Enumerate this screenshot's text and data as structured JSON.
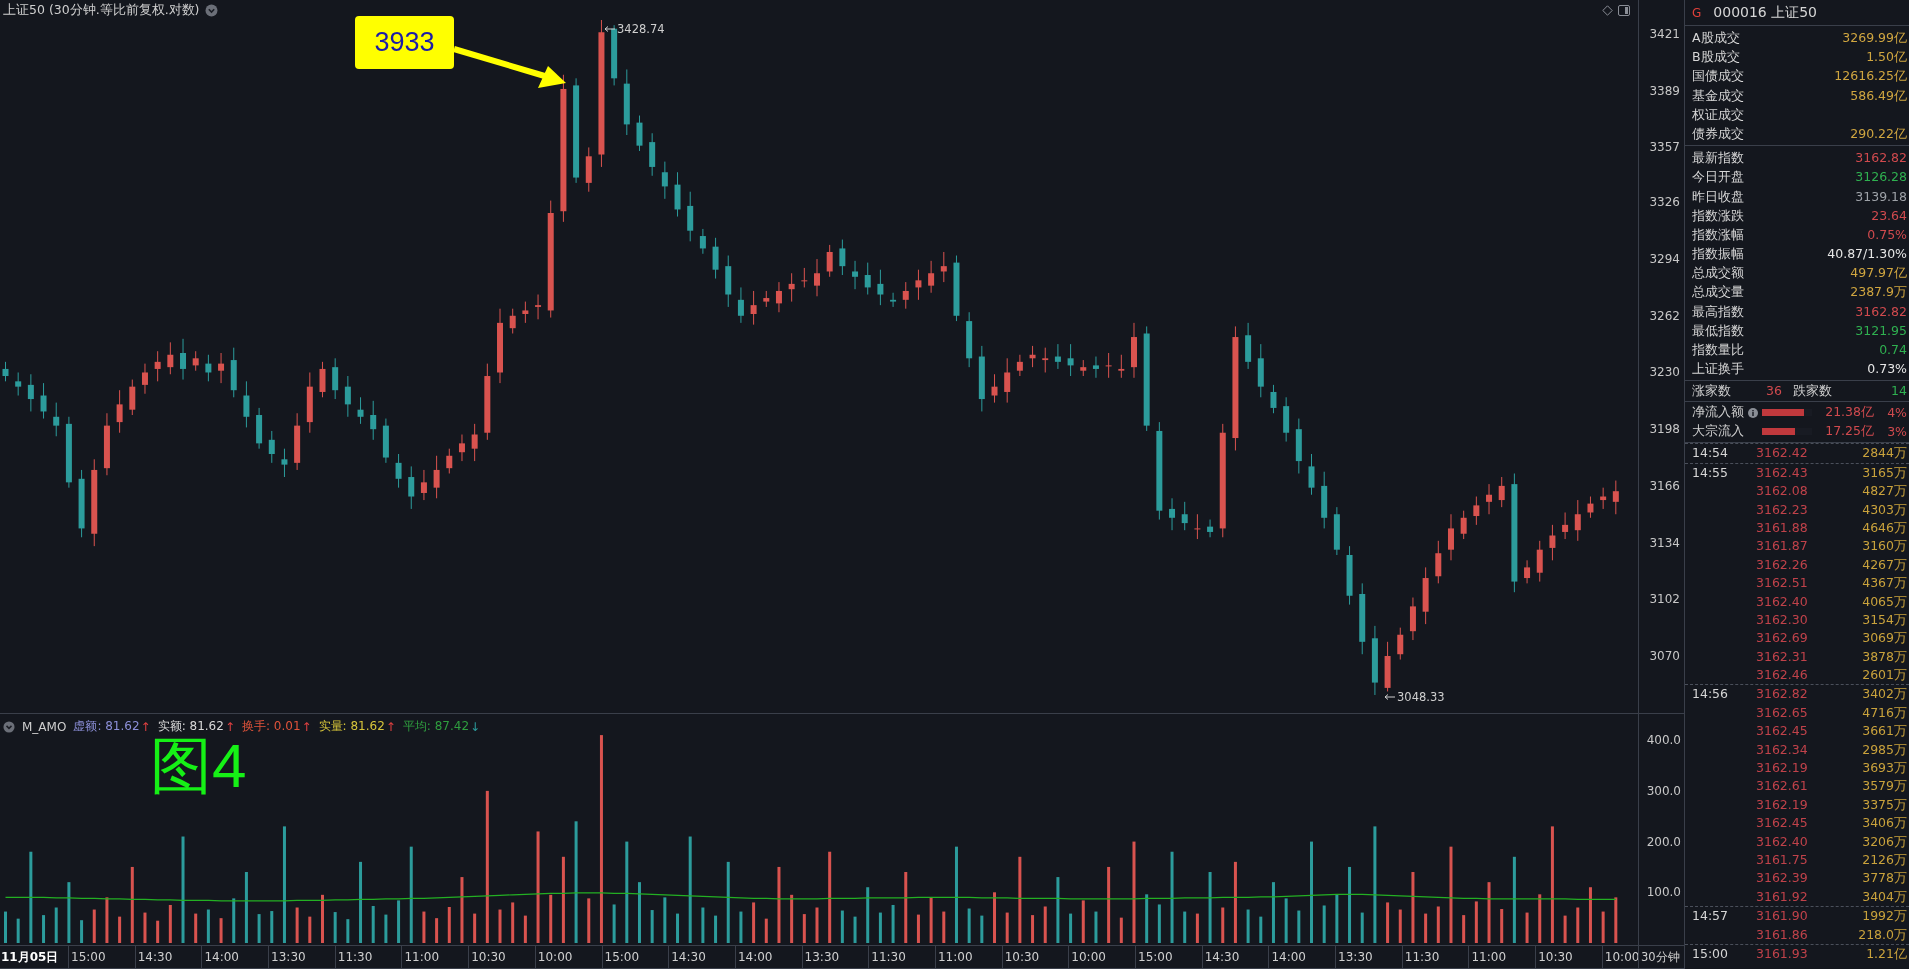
{
  "chart_header": {
    "title": "上证50 (30分钟.等比前复权.对数)"
  },
  "price_chart": {
    "chart_data": {
      "type": "candlestick",
      "categories": [
        null,
        null,
        null,
        null,
        null,
        null,
        null,
        null,
        null,
        null,
        null,
        null,
        null,
        null,
        null,
        null,
        null,
        null,
        null,
        null,
        null,
        null,
        null,
        null,
        null,
        null,
        null,
        null,
        null,
        null,
        null,
        null,
        null,
        null,
        null,
        null,
        null,
        null,
        null,
        null,
        null,
        null,
        null,
        null,
        null,
        null,
        null,
        null,
        null,
        null,
        null,
        null,
        null,
        null,
        null,
        null,
        null,
        null,
        null,
        null,
        null,
        null,
        null,
        null,
        null,
        null,
        null,
        null,
        null,
        null,
        null,
        null,
        null,
        null,
        null,
        null,
        null,
        null,
        null,
        null,
        null,
        null,
        null,
        null,
        null,
        null,
        null,
        null,
        null,
        null,
        null,
        null,
        null,
        null,
        null,
        null,
        null,
        null,
        null,
        null,
        null,
        null,
        null,
        null,
        null,
        null,
        null,
        null,
        null,
        null,
        null,
        null,
        null,
        null,
        null,
        null,
        null,
        null,
        null,
        null,
        null,
        null,
        null,
        null,
        null,
        null,
        null,
        null
      ],
      "ylim": [
        3038.4,
        3440.2
      ],
      "ohlc": [
        [
          3232,
          3236,
          3225,
          3228
        ],
        [
          3225,
          3230,
          3217,
          3222
        ],
        [
          3223,
          3229,
          3208,
          3215
        ],
        [
          3217,
          3224,
          3204,
          3208
        ],
        [
          3205,
          3213,
          3194,
          3200
        ],
        [
          3201,
          3205,
          3165,
          3168
        ],
        [
          3170,
          3175,
          3137,
          3142
        ],
        [
          3139,
          3181,
          3132,
          3175
        ],
        [
          3176,
          3207,
          3172,
          3200
        ],
        [
          3202,
          3220,
          3196,
          3212
        ],
        [
          3209,
          3226,
          3206,
          3222
        ],
        [
          3223,
          3235,
          3218,
          3230
        ],
        [
          3232,
          3242,
          3225,
          3236
        ],
        [
          3233,
          3247,
          3229,
          3240
        ],
        [
          3241,
          3249,
          3226,
          3232
        ],
        [
          3234,
          3242,
          3231,
          3238
        ],
        [
          3235,
          3240,
          3225,
          3230
        ],
        [
          3231,
          3241,
          3224,
          3235
        ],
        [
          3237,
          3244,
          3216,
          3220
        ],
        [
          3217,
          3225,
          3199,
          3205
        ],
        [
          3206,
          3210,
          3187,
          3190
        ],
        [
          3192,
          3197,
          3179,
          3184
        ],
        [
          3181,
          3187,
          3171,
          3178
        ],
        [
          3179,
          3207,
          3175,
          3200
        ],
        [
          3202,
          3230,
          3196,
          3222
        ],
        [
          3219,
          3236,
          3216,
          3232
        ],
        [
          3233,
          3238,
          3215,
          3220
        ],
        [
          3222,
          3228,
          3205,
          3212
        ],
        [
          3209,
          3216,
          3201,
          3205
        ],
        [
          3206,
          3214,
          3192,
          3198
        ],
        [
          3200,
          3204,
          3179,
          3182
        ],
        [
          3179,
          3184,
          3165,
          3170
        ],
        [
          3171,
          3177,
          3153,
          3160
        ],
        [
          3162,
          3175,
          3158,
          3168
        ],
        [
          3165,
          3183,
          3159,
          3175
        ],
        [
          3176,
          3187,
          3173,
          3183
        ],
        [
          3185,
          3195,
          3180,
          3190
        ],
        [
          3187,
          3201,
          3180,
          3195
        ],
        [
          3196,
          3235,
          3192,
          3228
        ],
        [
          3230,
          3266,
          3224,
          3258
        ],
        [
          3255,
          3266,
          3252,
          3262
        ],
        [
          3263,
          3270,
          3258,
          3265
        ],
        [
          3267,
          3274,
          3260,
          3268
        ],
        [
          3265,
          3327,
          3261,
          3320
        ],
        [
          3321,
          3398,
          3315,
          3390
        ],
        [
          3392,
          3396,
          3337,
          3340
        ],
        [
          3337,
          3357,
          3332,
          3352
        ],
        [
          3353,
          3429,
          3346,
          3422
        ],
        [
          3424,
          3426,
          3392,
          3396
        ],
        [
          3393,
          3401,
          3364,
          3370
        ],
        [
          3371,
          3375,
          3355,
          3358
        ],
        [
          3360,
          3365,
          3341,
          3346
        ],
        [
          3343,
          3349,
          3328,
          3335
        ],
        [
          3336,
          3343,
          3318,
          3322
        ],
        [
          3324,
          3332,
          3304,
          3310
        ],
        [
          3307,
          3311,
          3297,
          3300
        ],
        [
          3301,
          3306,
          3283,
          3288
        ],
        [
          3290,
          3296,
          3267,
          3274
        ],
        [
          3271,
          3278,
          3258,
          3262
        ],
        [
          3263,
          3276,
          3257,
          3268
        ],
        [
          3270,
          3276,
          3267,
          3272
        ],
        [
          3269,
          3281,
          3264,
          3276
        ],
        [
          3277,
          3286,
          3270,
          3280
        ],
        [
          3282,
          3289,
          3278,
          3282
        ],
        [
          3279,
          3294,
          3273,
          3286
        ],
        [
          3287,
          3302,
          3284,
          3298
        ],
        [
          3300,
          3305,
          3285,
          3290
        ],
        [
          3287,
          3293,
          3277,
          3284
        ],
        [
          3285,
          3292,
          3274,
          3278
        ],
        [
          3280,
          3288,
          3268,
          3274
        ],
        [
          3271,
          3275,
          3267,
          3270
        ],
        [
          3271,
          3281,
          3266,
          3276
        ],
        [
          3278,
          3288,
          3271,
          3282
        ],
        [
          3279,
          3293,
          3275,
          3286
        ],
        [
          3287,
          3298,
          3281,
          3290
        ],
        [
          3292,
          3296,
          3259,
          3262
        ],
        [
          3259,
          3264,
          3233,
          3238
        ],
        [
          3239,
          3245,
          3208,
          3215
        ],
        [
          3217,
          3229,
          3213,
          3222
        ],
        [
          3219,
          3238,
          3213,
          3230
        ],
        [
          3231,
          3240,
          3228,
          3236
        ],
        [
          3238,
          3245,
          3233,
          3240
        ],
        [
          3237,
          3244,
          3230,
          3238
        ],
        [
          3239,
          3246,
          3232,
          3236
        ],
        [
          3238,
          3246,
          3228,
          3234
        ],
        [
          3231,
          3237,
          3228,
          3233
        ],
        [
          3234,
          3239,
          3227,
          3232
        ],
        [
          3234,
          3241,
          3227,
          3234
        ],
        [
          3231,
          3240,
          3227,
          3232
        ],
        [
          3233,
          3258,
          3227,
          3250
        ],
        [
          3252,
          3256,
          3197,
          3200
        ],
        [
          3197,
          3202,
          3147,
          3152
        ],
        [
          3153,
          3159,
          3141,
          3148
        ],
        [
          3150,
          3157,
          3141,
          3145
        ],
        [
          3142,
          3150,
          3136,
          3142
        ],
        [
          3143,
          3147,
          3137,
          3140
        ],
        [
          3142,
          3201,
          3137,
          3196
        ],
        [
          3193,
          3256,
          3186,
          3250
        ],
        [
          3251,
          3258,
          3232,
          3236
        ],
        [
          3238,
          3246,
          3216,
          3222
        ],
        [
          3219,
          3223,
          3207,
          3210
        ],
        [
          3211,
          3216,
          3191,
          3196
        ],
        [
          3198,
          3204,
          3173,
          3180
        ],
        [
          3177,
          3184,
          3161,
          3165
        ],
        [
          3166,
          3174,
          3142,
          3148
        ],
        [
          3150,
          3154,
          3127,
          3130
        ],
        [
          3127,
          3132,
          3099,
          3104
        ],
        [
          3105,
          3111,
          3071,
          3078
        ],
        [
          3080,
          3087,
          3048,
          3055
        ],
        [
          3052,
          3078,
          3050,
          3070
        ],
        [
          3071,
          3086,
          3068,
          3082
        ],
        [
          3084,
          3103,
          3079,
          3098
        ],
        [
          3095,
          3120,
          3088,
          3114
        ],
        [
          3115,
          3135,
          3111,
          3128
        ],
        [
          3130,
          3150,
          3124,
          3142
        ],
        [
          3139,
          3152,
          3136,
          3148
        ],
        [
          3149,
          3160,
          3144,
          3155
        ],
        [
          3157,
          3167,
          3150,
          3161
        ],
        [
          3158,
          3171,
          3154,
          3166
        ],
        [
          3167,
          3173,
          3106,
          3112
        ],
        [
          3114,
          3124,
          3111,
          3120
        ],
        [
          3117,
          3135,
          3112,
          3130
        ],
        [
          3131,
          3144,
          3124,
          3138
        ],
        [
          3140,
          3151,
          3136,
          3144
        ],
        [
          3141,
          3158,
          3135,
          3150
        ],
        [
          3151,
          3160,
          3148,
          3156
        ],
        [
          3158,
          3165,
          3153,
          3160
        ],
        [
          3157,
          3169,
          3150,
          3163
        ]
      ],
      "yticks": [
        3421,
        3389,
        3357,
        3326,
        3294,
        3262,
        3230,
        3198,
        3166,
        3134,
        3102,
        3070
      ]
    },
    "high_label": "3428.74",
    "low_label": "3048.33"
  },
  "annotation": {
    "callout": "3933",
    "figure_label": "图4"
  },
  "indicator": {
    "name": "M_AMO",
    "values": [
      {
        "label": "虚额:",
        "value": "81.62",
        "arrow": "↑",
        "rising": true,
        "color": "#8c8fd8"
      },
      {
        "label": "实额:",
        "value": "81.62",
        "arrow": "↑",
        "rising": true,
        "color": "#d8d8d8"
      },
      {
        "label": "换手:",
        "value": "0.01",
        "arrow": "↑",
        "rising": true,
        "color": "#e0533a"
      },
      {
        "label": "实量:",
        "value": "81.62",
        "arrow": "↑",
        "rising": true,
        "color": "#d6c43a"
      },
      {
        "label": "平均:",
        "value": "87.42",
        "arrow": "↓",
        "rising": false,
        "color": "#2f9e3f"
      }
    ]
  },
  "volume_chart": {
    "chart_data": {
      "type": "bar",
      "categories": [
        null,
        null,
        null,
        null,
        null,
        null,
        null,
        null,
        null,
        null,
        null,
        null,
        null,
        null,
        null,
        null,
        null,
        null,
        null,
        null,
        null,
        null,
        null,
        null,
        null,
        null,
        null,
        null,
        null,
        null,
        null,
        null,
        null,
        null,
        null,
        null,
        null,
        null,
        null,
        null,
        null,
        null,
        null,
        null,
        null,
        null,
        null,
        null,
        null,
        null,
        null,
        null,
        null,
        null,
        null,
        null,
        null,
        null,
        null,
        null,
        null,
        null,
        null,
        null,
        null,
        null,
        null,
        null,
        null,
        null,
        null,
        null,
        null,
        null,
        null,
        null,
        null,
        null,
        null,
        null,
        null,
        null,
        null,
        null,
        null,
        null,
        null,
        null,
        null,
        null,
        null,
        null,
        null,
        null,
        null,
        null,
        null,
        null,
        null,
        null,
        null,
        null,
        null,
        null,
        null,
        null,
        null,
        null,
        null,
        null,
        null,
        null,
        null,
        null,
        null,
        null,
        null,
        null,
        null,
        null,
        null,
        null,
        null,
        null,
        null,
        null,
        null,
        null
      ],
      "ylim": [
        0,
        453.6
      ],
      "series": [
        {
          "type": "bar",
          "colors": [
            "#2c9c9c",
            "#2c9c9c",
            "#2c9c9c",
            "#2c9c9c",
            "#2c9c9c",
            "#2c9c9c",
            "#2c9c9c",
            "#d9534f",
            "#d9534f",
            "#d9534f",
            "#d9534f",
            "#d9534f",
            "#d9534f",
            "#d9534f",
            "#2c9c9c",
            "#d9534f",
            "#2c9c9c",
            "#d9534f",
            "#2c9c9c",
            "#2c9c9c",
            "#2c9c9c",
            "#2c9c9c",
            "#2c9c9c",
            "#d9534f",
            "#d9534f",
            "#d9534f",
            "#2c9c9c",
            "#2c9c9c",
            "#2c9c9c",
            "#2c9c9c",
            "#2c9c9c",
            "#2c9c9c",
            "#2c9c9c",
            "#d9534f",
            "#d9534f",
            "#d9534f",
            "#d9534f",
            "#d9534f",
            "#d9534f",
            "#d9534f",
            "#d9534f",
            "#d9534f",
            "#d9534f",
            "#d9534f",
            "#d9534f",
            "#2c9c9c",
            "#d9534f",
            "#d9534f",
            "#2c9c9c",
            "#2c9c9c",
            "#2c9c9c",
            "#2c9c9c",
            "#2c9c9c",
            "#2c9c9c",
            "#2c9c9c",
            "#2c9c9c",
            "#2c9c9c",
            "#2c9c9c",
            "#2c9c9c",
            "#d9534f",
            "#d9534f",
            "#d9534f",
            "#d9534f",
            "#d9534f",
            "#d9534f",
            "#d9534f",
            "#2c9c9c",
            "#2c9c9c",
            "#2c9c9c",
            "#2c9c9c",
            "#2c9c9c",
            "#d9534f",
            "#d9534f",
            "#d9534f",
            "#d9534f",
            "#2c9c9c",
            "#2c9c9c",
            "#2c9c9c",
            "#d9534f",
            "#d9534f",
            "#d9534f",
            "#d9534f",
            "#d9534f",
            "#2c9c9c",
            "#2c9c9c",
            "#d9534f",
            "#2c9c9c",
            "#d9534f",
            "#d9534f",
            "#d9534f",
            "#2c9c9c",
            "#2c9c9c",
            "#2c9c9c",
            "#2c9c9c",
            "#d9534f",
            "#2c9c9c",
            "#d9534f",
            "#d9534f",
            "#2c9c9c",
            "#2c9c9c",
            "#2c9c9c",
            "#2c9c9c",
            "#2c9c9c",
            "#2c9c9c",
            "#2c9c9c",
            "#2c9c9c",
            "#2c9c9c",
            "#2c9c9c",
            "#2c9c9c",
            "#d9534f",
            "#d9534f",
            "#d9534f",
            "#d9534f",
            "#d9534f",
            "#d9534f",
            "#d9534f",
            "#d9534f",
            "#d9534f",
            "#d9534f",
            "#2c9c9c",
            "#d9534f",
            "#d9534f",
            "#d9534f",
            "#d9534f",
            "#d9534f",
            "#d9534f",
            "#d9534f",
            "#d9534f"
          ],
          "values": [
            62,
            48,
            180,
            55,
            70,
            120,
            45,
            66,
            90,
            52,
            150,
            60,
            44,
            75,
            210,
            58,
            66,
            49,
            88,
            140,
            57,
            63,
            230,
            70,
            52,
            95,
            61,
            47,
            160,
            73,
            56,
            84,
            190,
            62,
            49,
            71,
            130,
            58,
            300,
            66,
            80,
            54,
            220,
            95,
            170,
            240,
            88,
            410,
            76,
            200,
            120,
            65,
            90,
            58,
            210,
            70,
            54,
            160,
            62,
            80,
            48,
            150,
            95,
            57,
            70,
            180,
            64,
            52,
            110,
            60,
            75,
            140,
            56,
            90,
            62,
            190,
            68,
            54,
            100,
            60,
            170,
            55,
            72,
            130,
            58,
            84,
            62,
            150,
            50,
            200,
            96,
            76,
            180,
            62,
            58,
            140,
            70,
            160,
            66,
            52,
            120,
            88,
            64,
            200,
            74,
            95,
            150,
            60,
            230,
            80,
            66,
            140,
            58,
            72,
            190,
            55,
            82,
            120,
            67,
            170,
            60,
            96,
            230,
            54,
            70,
            110,
            62,
            90
          ]
        },
        {
          "type": "line",
          "values": [
            90,
            90,
            90,
            90,
            89,
            89,
            88,
            88,
            87,
            87,
            86,
            86,
            85,
            85,
            84,
            84,
            84,
            83,
            83,
            83,
            83,
            83,
            83,
            84,
            84,
            84,
            85,
            85,
            86,
            86,
            87,
            87,
            88,
            88,
            89,
            90,
            91,
            92,
            93,
            94,
            95,
            96,
            97,
            98,
            98,
            99,
            99,
            99,
            98,
            98,
            97,
            96,
            95,
            94,
            93,
            92,
            91,
            90,
            89,
            88,
            88,
            87,
            87,
            87,
            87,
            88,
            88,
            88,
            89,
            89,
            89,
            89,
            90,
            90,
            90,
            90,
            90,
            89,
            89,
            89,
            88,
            88,
            88,
            88,
            87,
            87,
            87,
            87,
            87,
            87,
            88,
            88,
            88,
            89,
            89,
            89,
            90,
            90,
            90,
            91,
            91,
            92,
            93,
            94,
            95,
            96,
            96,
            96,
            95,
            94,
            93,
            92,
            91,
            90,
            89,
            88,
            88,
            87,
            87,
            87,
            87,
            87,
            87,
            87,
            86,
            86,
            86,
            86
          ]
        }
      ],
      "yticks": [
        {
          "value": 400,
          "label": "400.0"
        },
        {
          "value": 300,
          "label": "300.0"
        },
        {
          "value": 200,
          "label": "200.0"
        },
        {
          "value": 100,
          "label": "100.0"
        }
      ]
    }
  },
  "time_axis": {
    "labels": [
      "11月05日",
      "15:00",
      "14:30",
      "14:00",
      "13:30",
      "11:30",
      "11:00",
      "10:30",
      "10:00",
      "15:00",
      "14:30",
      "14:00",
      "13:30",
      "11:30",
      "11:00",
      "10:30",
      "10:00",
      "15:00",
      "14:30",
      "14:00",
      "13:30",
      "11:30",
      "11:00",
      "10:30",
      "10:00"
    ],
    "period": "30分钟"
  },
  "quote": {
    "marker": "G",
    "code": "000016",
    "name": "上证50",
    "turnover_rows": [
      {
        "label": "A股成交",
        "value": "3269.99亿"
      },
      {
        "label": "B股成交",
        "value": "1.50亿"
      },
      {
        "label": "国债成交",
        "value": "12616.25亿"
      },
      {
        "label": "基金成交",
        "value": "586.49亿"
      },
      {
        "label": "权证成交"
      },
      {
        "label": "债券成交",
        "value": "290.22亿"
      }
    ],
    "index_rows": [
      {
        "label": "最新指数",
        "value": "3162.82",
        "color": "#d04a4e"
      },
      {
        "label": "今日开盘",
        "value": "3126.28",
        "color": "#2fb050"
      },
      {
        "label": "昨日收盘",
        "value": "3139.18",
        "color": "#9ea2a8"
      },
      {
        "label": "指数涨跌",
        "value": "23.64",
        "color": "#d04a4e"
      },
      {
        "label": "指数涨幅",
        "value": "0.75%",
        "color": "#d04a4e"
      },
      {
        "label": "指数振幅",
        "value": "40.87/1.30%",
        "color": "#e6e6e6"
      },
      {
        "label": "总成交额",
        "value": "497.97亿",
        "color": "#d0a640"
      },
      {
        "label": "总成交量",
        "value": "2387.9万",
        "color": "#d0a640"
      },
      {
        "label": "最高指数",
        "value": "3162.82",
        "color": "#d04a4e"
      },
      {
        "label": "最低指数",
        "value": "3121.95",
        "color": "#2fb050"
      },
      {
        "label": "指数量比",
        "value": "0.74",
        "color": "#2fb050"
      },
      {
        "label": "上证换手",
        "value": "0.73%",
        "color": "#e6e6e6"
      }
    ],
    "breadth": {
      "up_label": "涨家数",
      "up_count": "36",
      "down_label": "跌家数",
      "down_count": "14"
    },
    "flows": [
      {
        "label": "净流入额",
        "value": "21.38亿",
        "share": "4%",
        "level": 0.84,
        "info": true
      },
      {
        "label": "大宗流入",
        "value": "17.25亿",
        "share": "3%",
        "level": 0.66,
        "info": false
      }
    ],
    "tick_groups": [
      {
        "time": "14:54",
        "ticks": [
          {
            "price": "3162.42",
            "volume": "2844万"
          }
        ]
      },
      {
        "time": "14:55",
        "ticks": [
          {
            "price": "3162.43",
            "volume": "3165万"
          },
          {
            "price": "3162.08",
            "volume": "4827万"
          },
          {
            "price": "3162.23",
            "volume": "4303万"
          },
          {
            "price": "3161.88",
            "volume": "4646万"
          },
          {
            "price": "3161.87",
            "volume": "3160万"
          },
          {
            "price": "3162.26",
            "volume": "4267万"
          },
          {
            "price": "3162.51",
            "volume": "4367万"
          },
          {
            "price": "3162.40",
            "volume": "4065万"
          },
          {
            "price": "3162.30",
            "volume": "3154万"
          },
          {
            "price": "3162.69",
            "volume": "3069万"
          },
          {
            "price": "3162.31",
            "volume": "3878万"
          },
          {
            "price": "3162.46",
            "volume": "2601万"
          }
        ]
      },
      {
        "time": "14:56",
        "ticks": [
          {
            "price": "3162.82",
            "volume": "3402万"
          },
          {
            "price": "3162.65",
            "volume": "4716万"
          },
          {
            "price": "3162.45",
            "volume": "3661万"
          },
          {
            "price": "3162.34",
            "volume": "2985万"
          },
          {
            "price": "3162.19",
            "volume": "3693万"
          },
          {
            "price": "3162.61",
            "volume": "3579万"
          },
          {
            "price": "3162.19",
            "volume": "3375万"
          },
          {
            "price": "3162.45",
            "volume": "3406万"
          },
          {
            "price": "3162.40",
            "volume": "3206万"
          },
          {
            "price": "3161.75",
            "volume": "2126万"
          },
          {
            "price": "3162.39",
            "volume": "3778万"
          },
          {
            "price": "3161.92",
            "volume": "3404万"
          }
        ]
      },
      {
        "time": "14:57",
        "ticks": [
          {
            "price": "3161.90",
            "volume": "1992万"
          },
          {
            "price": "3161.86",
            "volume": "218.0万"
          }
        ]
      },
      {
        "time": "15:00",
        "ticks": [
          {
            "price": "3161.93",
            "volume": "1.21亿"
          }
        ]
      }
    ]
  }
}
